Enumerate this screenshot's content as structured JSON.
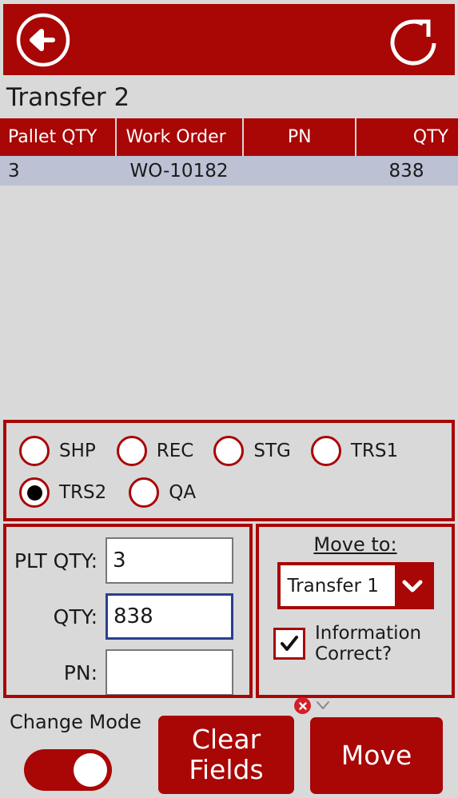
{
  "topbar": {
    "back_icon": "back-arrow-circle-icon",
    "refresh_icon": "refresh-rotate-icon"
  },
  "page_title": "Transfer 2",
  "table": {
    "columns": [
      "Pallet QTY",
      "Work Order",
      "PN",
      "QTY"
    ],
    "rows": [
      {
        "pallet_qty": "3",
        "work_order": "WO-10182",
        "pn": "",
        "qty": "838"
      }
    ]
  },
  "location_radios": {
    "selected": "TRS2",
    "row1": [
      {
        "label": "SHP",
        "checked": false
      },
      {
        "label": "REC",
        "checked": false
      },
      {
        "label": "STG",
        "checked": false
      },
      {
        "label": "TRS1",
        "checked": false
      }
    ],
    "row2": [
      {
        "label": "TRS2",
        "checked": true
      },
      {
        "label": "QA",
        "checked": false
      }
    ]
  },
  "form": {
    "fields": [
      {
        "label": "PLT QTY:",
        "value": "3",
        "placeholder": "",
        "focused": false
      },
      {
        "label": "QTY:",
        "value": "838",
        "placeholder": "",
        "focused": true
      },
      {
        "label": "PN:",
        "value": "",
        "placeholder": "",
        "focused": false
      }
    ]
  },
  "move_to": {
    "label": "Move to:",
    "selected": "Transfer 1",
    "options": [
      "Transfer 1"
    ],
    "chevron_icon": "chevron-down-icon"
  },
  "confirm": {
    "checked": true,
    "line1": "Information",
    "line2": "Correct?",
    "check_icon": "checkmark-icon"
  },
  "notice": {
    "close_icon": "close-x-circle-icon",
    "expand_icon": "chevron-down-icon"
  },
  "bottom": {
    "change_mode_label": "Change Mode",
    "change_mode_on": true,
    "clear_button": "Clear Fields",
    "move_button": "Move"
  },
  "colors": {
    "brand_red": "#a90606",
    "background": "#d9d9d9",
    "row_highlight": "#bcc2d3",
    "focus_blue": "#2a3f8f",
    "badge_red": "#d21f29"
  }
}
